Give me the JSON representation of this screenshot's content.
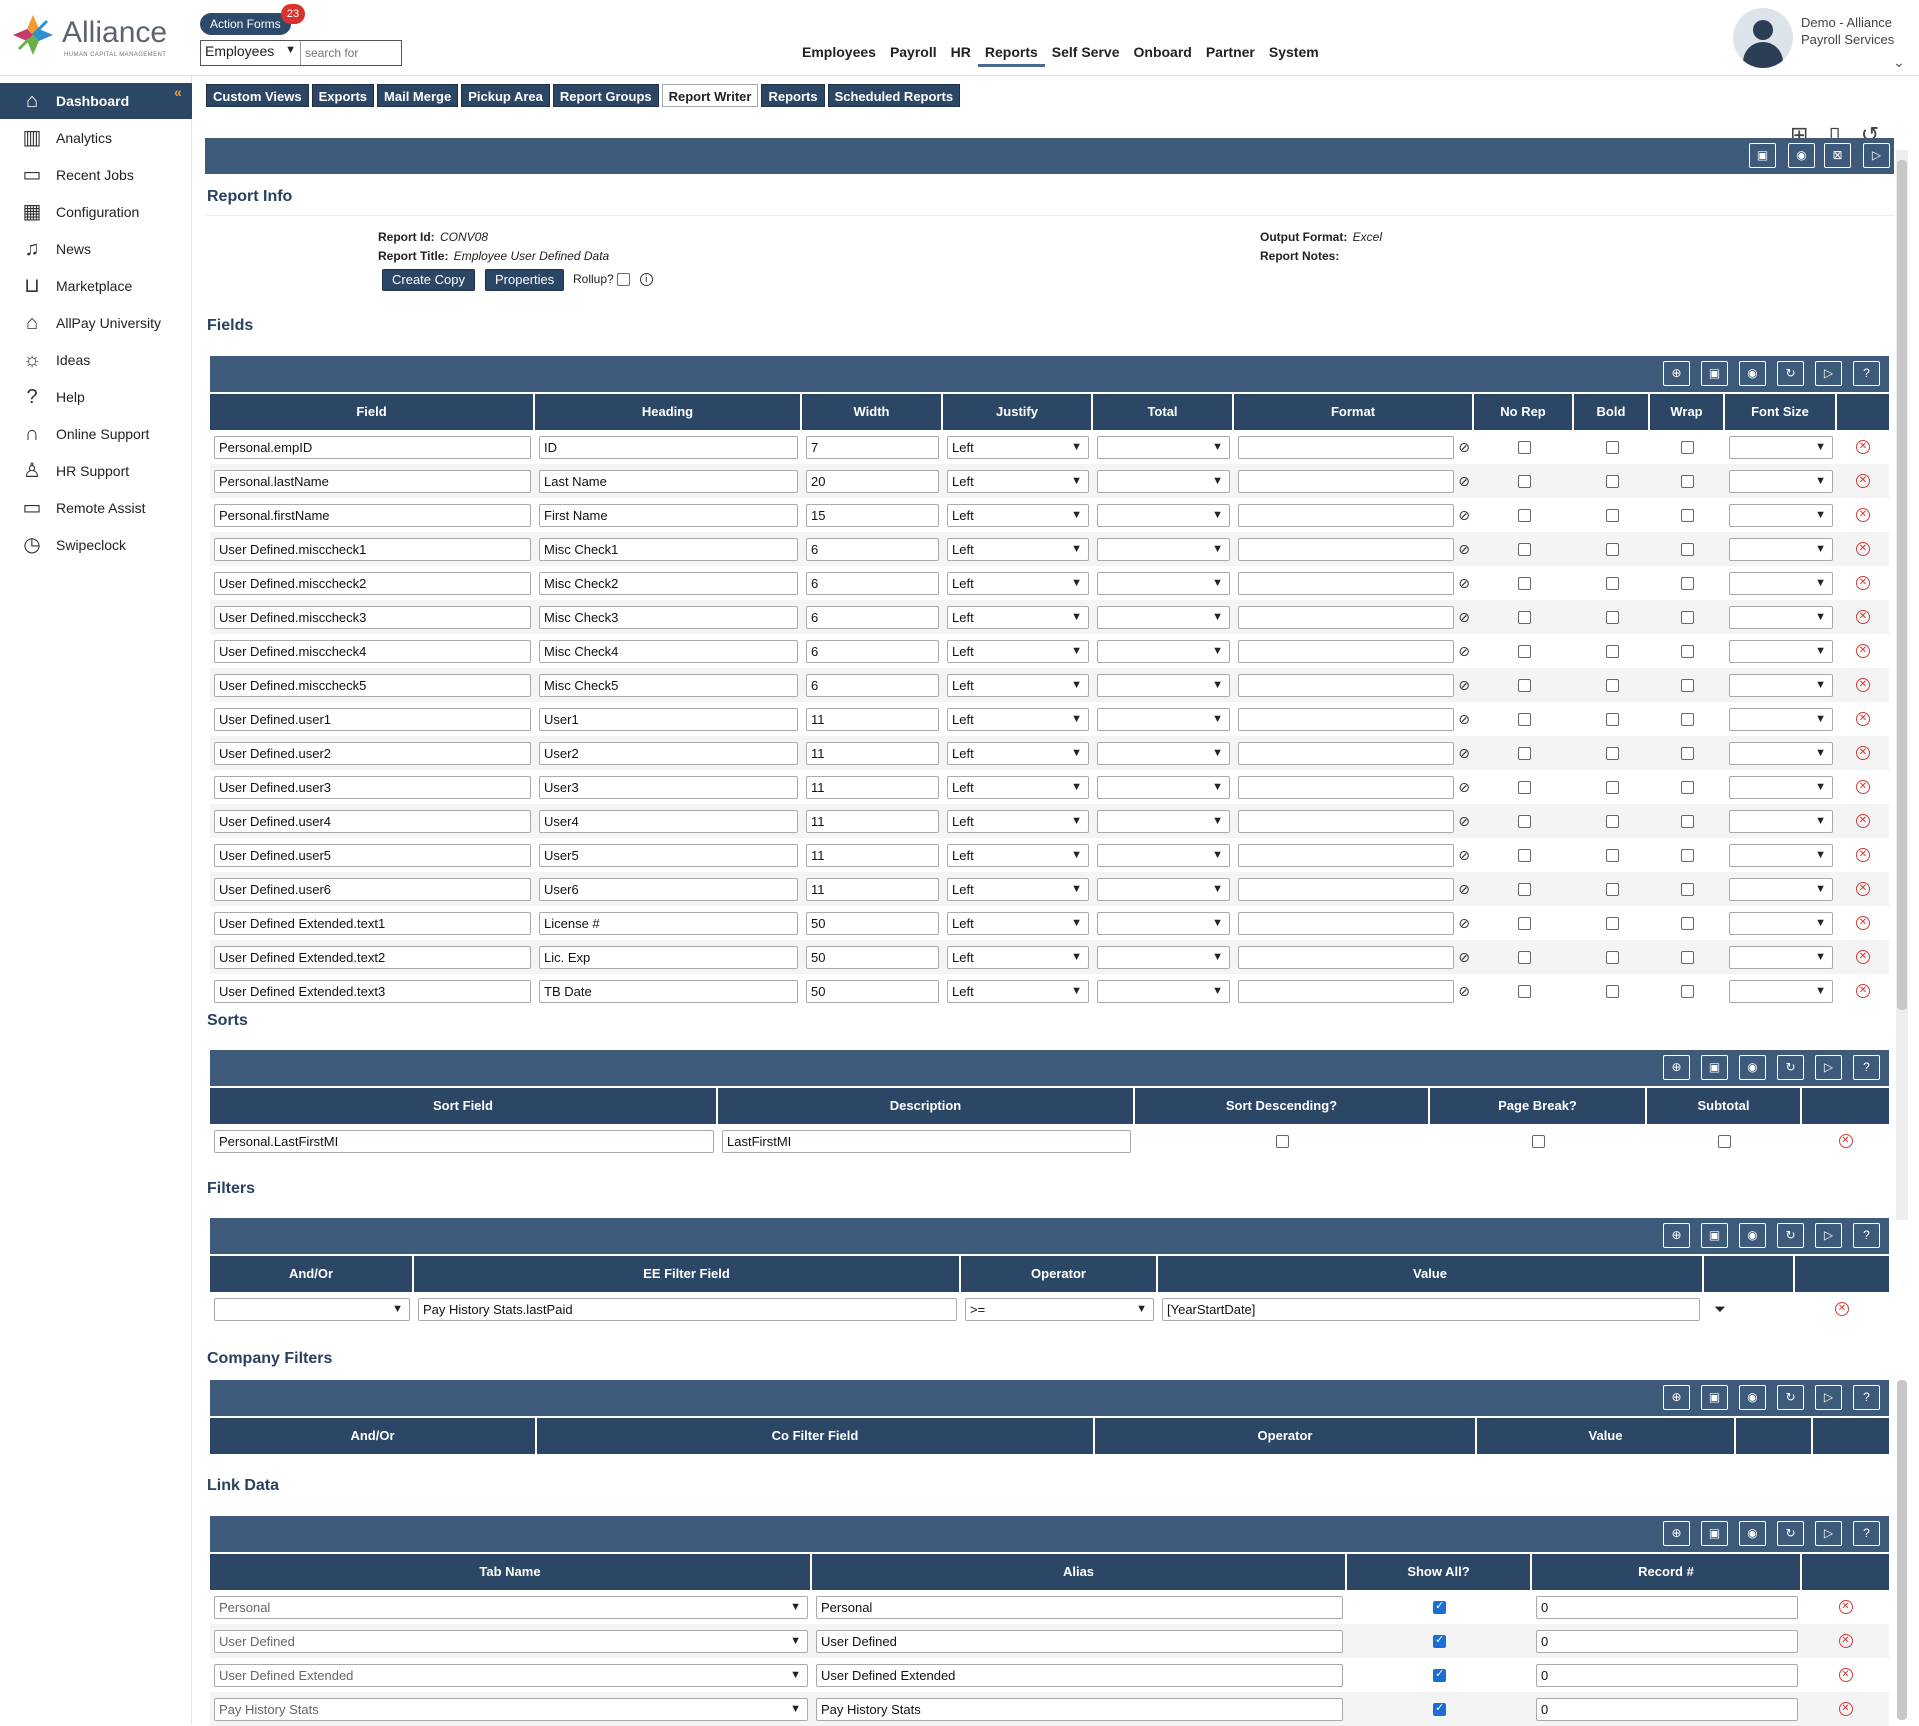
{
  "header": {
    "logo_text": "Alliance",
    "logo_subtitle": "HUMAN CAPITAL MANAGEMENT",
    "action_forms_label": "Action Forms",
    "action_forms_count": "23",
    "search_scope": "Employees",
    "search_placeholder": "search for",
    "nav": [
      "Employees",
      "Payroll",
      "HR",
      "Reports",
      "Self Serve",
      "Onboard",
      "Partner",
      "System"
    ],
    "nav_active": "Reports",
    "user_name": "Demo - Alliance Payroll Services"
  },
  "sidebar": {
    "items": [
      {
        "label": "Dashboard",
        "icon": "home-icon"
      },
      {
        "label": "Analytics",
        "icon": "chart-icon"
      },
      {
        "label": "Recent Jobs",
        "icon": "briefcase-icon"
      },
      {
        "label": "Configuration",
        "icon": "building-icon"
      },
      {
        "label": "News",
        "icon": "bell-icon"
      },
      {
        "label": "Marketplace",
        "icon": "basket-icon"
      },
      {
        "label": "AllPay University",
        "icon": "graduation-cap-icon"
      },
      {
        "label": "Ideas",
        "icon": "lightbulb-icon"
      },
      {
        "label": "Help",
        "icon": "question-icon"
      },
      {
        "label": "Online Support",
        "icon": "headset-icon"
      },
      {
        "label": "HR Support",
        "icon": "person-icon"
      },
      {
        "label": "Remote Assist",
        "icon": "monitor-icon"
      },
      {
        "label": "Swipeclock",
        "icon": "clock-icon"
      }
    ]
  },
  "subtabs": [
    "Custom Views",
    "Exports",
    "Mail Merge",
    "Pickup Area",
    "Report Groups",
    "Report Writer",
    "Reports",
    "Scheduled Reports"
  ],
  "subtab_active": "Report Writer",
  "report_info": {
    "title": "Report Info",
    "report_id_label": "Report Id:",
    "report_id": "CONV08",
    "report_title_label": "Report Title:",
    "report_title": "Employee User Defined Data",
    "output_format_label": "Output Format:",
    "output_format": "Excel",
    "report_notes_label": "Report Notes:",
    "create_copy": "Create Copy",
    "properties": "Properties",
    "rollup": "Rollup?"
  },
  "fields": {
    "title": "Fields",
    "columns": [
      "Field",
      "Heading",
      "Width",
      "Justify",
      "Total",
      "Format",
      "No Rep",
      "Bold",
      "Wrap",
      "Font Size"
    ],
    "rows": [
      [
        "Personal.empID",
        "ID",
        "7",
        "Left"
      ],
      [
        "Personal.lastName",
        "Last Name",
        "20",
        "Left"
      ],
      [
        "Personal.firstName",
        "First Name",
        "15",
        "Left"
      ],
      [
        "User Defined.misccheck1",
        "Misc Check1",
        "6",
        "Left"
      ],
      [
        "User Defined.misccheck2",
        "Misc Check2",
        "6",
        "Left"
      ],
      [
        "User Defined.misccheck3",
        "Misc Check3",
        "6",
        "Left"
      ],
      [
        "User Defined.misccheck4",
        "Misc Check4",
        "6",
        "Left"
      ],
      [
        "User Defined.misccheck5",
        "Misc Check5",
        "6",
        "Left"
      ],
      [
        "User Defined.user1",
        "User1",
        "11",
        "Left"
      ],
      [
        "User Defined.user2",
        "User2",
        "11",
        "Left"
      ],
      [
        "User Defined.user3",
        "User3",
        "11",
        "Left"
      ],
      [
        "User Defined.user4",
        "User4",
        "11",
        "Left"
      ],
      [
        "User Defined.user5",
        "User5",
        "11",
        "Left"
      ],
      [
        "User Defined.user6",
        "User6",
        "11",
        "Left"
      ],
      [
        "User Defined Extended.text1",
        "License #",
        "50",
        "Left"
      ],
      [
        "User Defined Extended.text2",
        "Lic. Exp",
        "50",
        "Left"
      ],
      [
        "User Defined Extended.text3",
        "TB Date",
        "50",
        "Left"
      ]
    ]
  },
  "sorts": {
    "title": "Sorts",
    "columns": [
      "Sort Field",
      "Description",
      "Sort Descending?",
      "Page Break?",
      "Subtotal"
    ],
    "rows": [
      [
        "Personal.LastFirstMI",
        "LastFirstMI"
      ]
    ]
  },
  "filters": {
    "title": "Filters",
    "columns": [
      "And/Or",
      "EE Filter Field",
      "Operator",
      "Value"
    ],
    "rows": [
      [
        "",
        "Pay History Stats.lastPaid",
        ">=",
        "[YearStartDate]"
      ]
    ]
  },
  "company_filters": {
    "title": "Company Filters",
    "columns": [
      "And/Or",
      "Co Filter Field",
      "Operator",
      "Value"
    ]
  },
  "link_data": {
    "title": "Link Data",
    "columns": [
      "Tab Name",
      "Alias",
      "Show All?",
      "Record #"
    ],
    "rows": [
      [
        "Personal",
        "Personal",
        "0"
      ],
      [
        "User Defined",
        "User Defined",
        "0"
      ],
      [
        "User Defined Extended",
        "User Defined Extended",
        "0"
      ],
      [
        "Pay History Stats",
        "Pay History Stats",
        "0"
      ]
    ]
  }
}
